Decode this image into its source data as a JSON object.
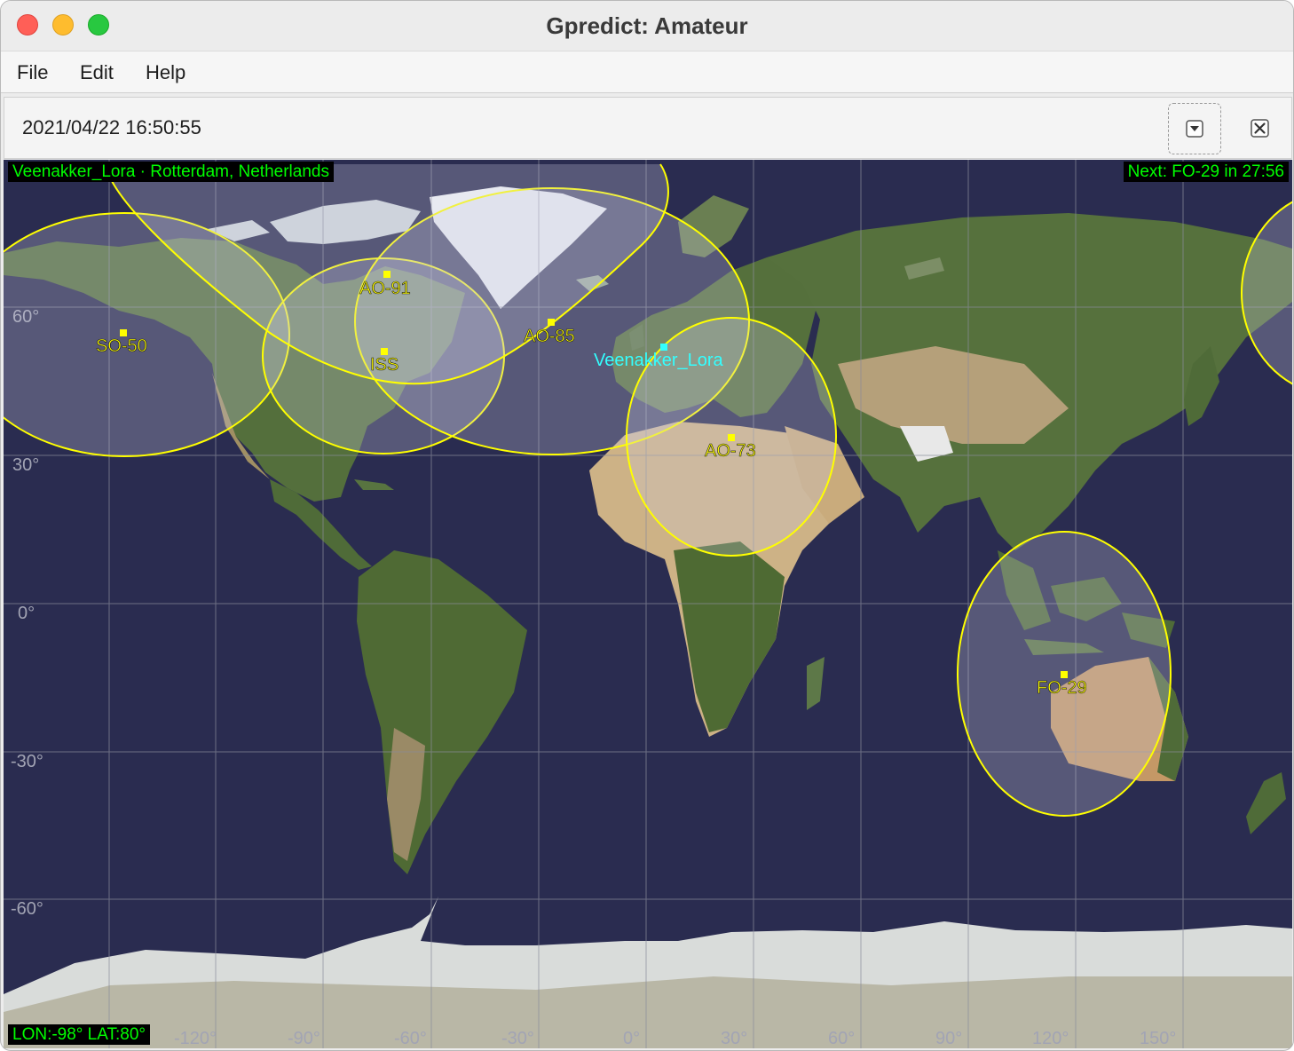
{
  "window": {
    "title": "Gpredict: Amateur"
  },
  "menu": {
    "file": "File",
    "edit": "Edit",
    "help": "Help"
  },
  "toolbar": {
    "datetime": "2021/04/22 16:50:55"
  },
  "map": {
    "qth_info": "Veenakker_Lora · Rotterdam, Netherlands",
    "next_event": "Next: FO-29 in 27:56",
    "cursor": "LON:-98° LAT:80°",
    "ground_station": {
      "name": "Veenakker_Lora",
      "lon": 4.5,
      "lat": 52
    },
    "lat_labels": [
      "60°",
      "30°",
      "0°",
      "-30°",
      "-60°"
    ],
    "lon_labels": [
      "-120°",
      "-90°",
      "-60°",
      "-30°",
      "0°",
      "30°",
      "60°",
      "90°",
      "120°",
      "150°"
    ],
    "satellites": [
      {
        "name": "SO-50",
        "lon": -122,
        "lat": 55
      },
      {
        "name": "AO-91",
        "lon": -72,
        "lat": 68
      },
      {
        "name": "ISS",
        "lon": -73,
        "lat": 52
      },
      {
        "name": "AO-85",
        "lon": -21,
        "lat": 58
      },
      {
        "name": "AO-73",
        "lon": 28,
        "lat": 35
      },
      {
        "name": "FO-29",
        "lon": 122,
        "lat": -13
      }
    ],
    "colors": {
      "footprint": "#ffff00",
      "satellite": "#ffff00",
      "ground_station": "#33ffff",
      "info_text": "#00ff00",
      "ocean": "#2a2c50",
      "grid": "#8a8c9a"
    }
  }
}
